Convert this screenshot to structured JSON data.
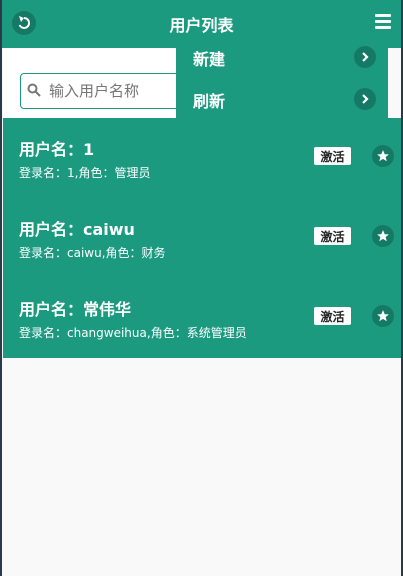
{
  "header": {
    "title": "用户列表",
    "back_icon": "back-arrow-icon",
    "menu_icon": "hamburger-menu-icon"
  },
  "search": {
    "placeholder": "输入用户名称"
  },
  "dropdown": {
    "items": [
      {
        "label": "新建"
      },
      {
        "label": "刷新"
      }
    ]
  },
  "users": [
    {
      "name": "用户名：1",
      "meta": "登录名：1,角色：管理员",
      "status": "激活"
    },
    {
      "name": "用户名：caiwu",
      "meta": "登录名：caiwu,角色：财务",
      "status": "激活"
    },
    {
      "name": "用户名：常伟华",
      "meta": "登录名：changweihua,角色：系统管理员",
      "status": "激活"
    }
  ],
  "colors": {
    "accent": "#1b9a80",
    "accent_dark": "#157a65"
  }
}
